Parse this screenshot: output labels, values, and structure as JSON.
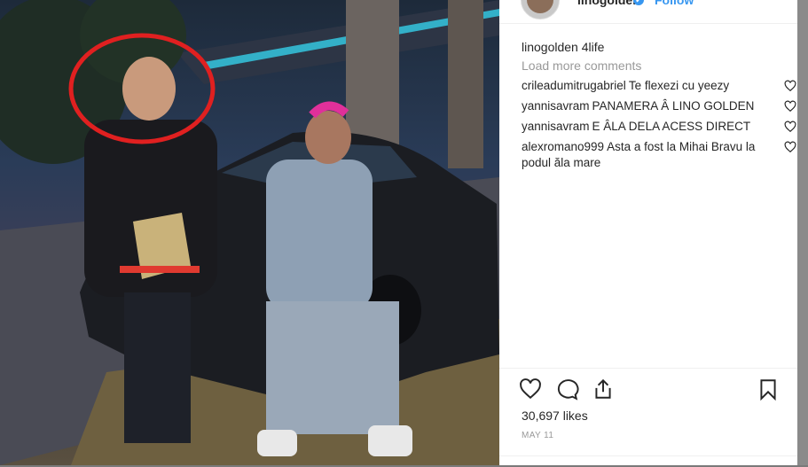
{
  "post": {
    "username": "linogolden",
    "verified_mark": "✔",
    "follow_label": "Follow"
  },
  "caption": {
    "username": "linogolden",
    "text": "4life"
  },
  "load_more_label": "Load more comments",
  "comments": [
    {
      "user": "crileadumitrugabriel",
      "text": "Te flexezi cu yeezy"
    },
    {
      "user": "yannisavram",
      "text": "PANAMERA Â LINO GOLDEN"
    },
    {
      "user": "yannisavram",
      "text": "E ÂLA DELA ACESS DIRECT"
    },
    {
      "user": "alexromano999",
      "text": "Asta a fost la Mihai Bravu la podul ăla mare"
    }
  ],
  "likes_text": "30,697 likes",
  "date_text": "MAY 11",
  "icons": {
    "like": "heart-icon",
    "comment": "comment-icon",
    "share": "share-icon",
    "save": "bookmark-icon",
    "comment_like": "heart-icon"
  },
  "colors": {
    "link_blue": "#3897f0",
    "text": "#262626",
    "muted": "#999999",
    "highlight_circle": "#e02020"
  }
}
